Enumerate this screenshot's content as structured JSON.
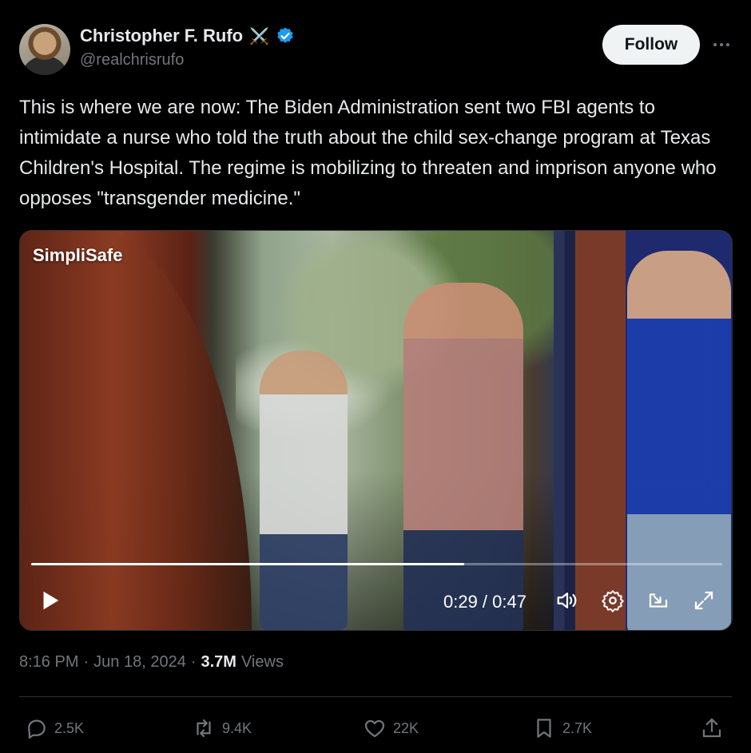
{
  "author": {
    "display_name": "Christopher F. Rufo",
    "handle": "@realchrisrufo",
    "badge_emoji": "⚔️",
    "verified_color": "#1d9bf0"
  },
  "follow_label": "Follow",
  "tweet_text": "This is where we are now: The Biden Administration sent two FBI agents to intimidate a nurse who told the truth about the child sex-change program at Texas Children's Hospital. The regime is mobilizing to threaten and imprison anyone who opposes \"transgender medicine.\"",
  "video": {
    "watermark": "SimpliSafe",
    "time_display": "0:29 / 0:47",
    "progress_fraction": 0.627
  },
  "meta": {
    "time": "8:16 PM",
    "separator": "·",
    "date": "Jun 18, 2024",
    "views_count": "3.7M",
    "views_label": "Views"
  },
  "actions": {
    "replies": "2.5K",
    "reposts": "9.4K",
    "likes": "22K",
    "bookmarks": "2.7K"
  },
  "icons": [
    "more-icon",
    "verified-icon",
    "play-icon",
    "volume-icon",
    "settings-icon",
    "pip-icon",
    "fullscreen-icon",
    "reply-icon",
    "repost-icon",
    "like-icon",
    "bookmark-icon",
    "share-icon"
  ]
}
